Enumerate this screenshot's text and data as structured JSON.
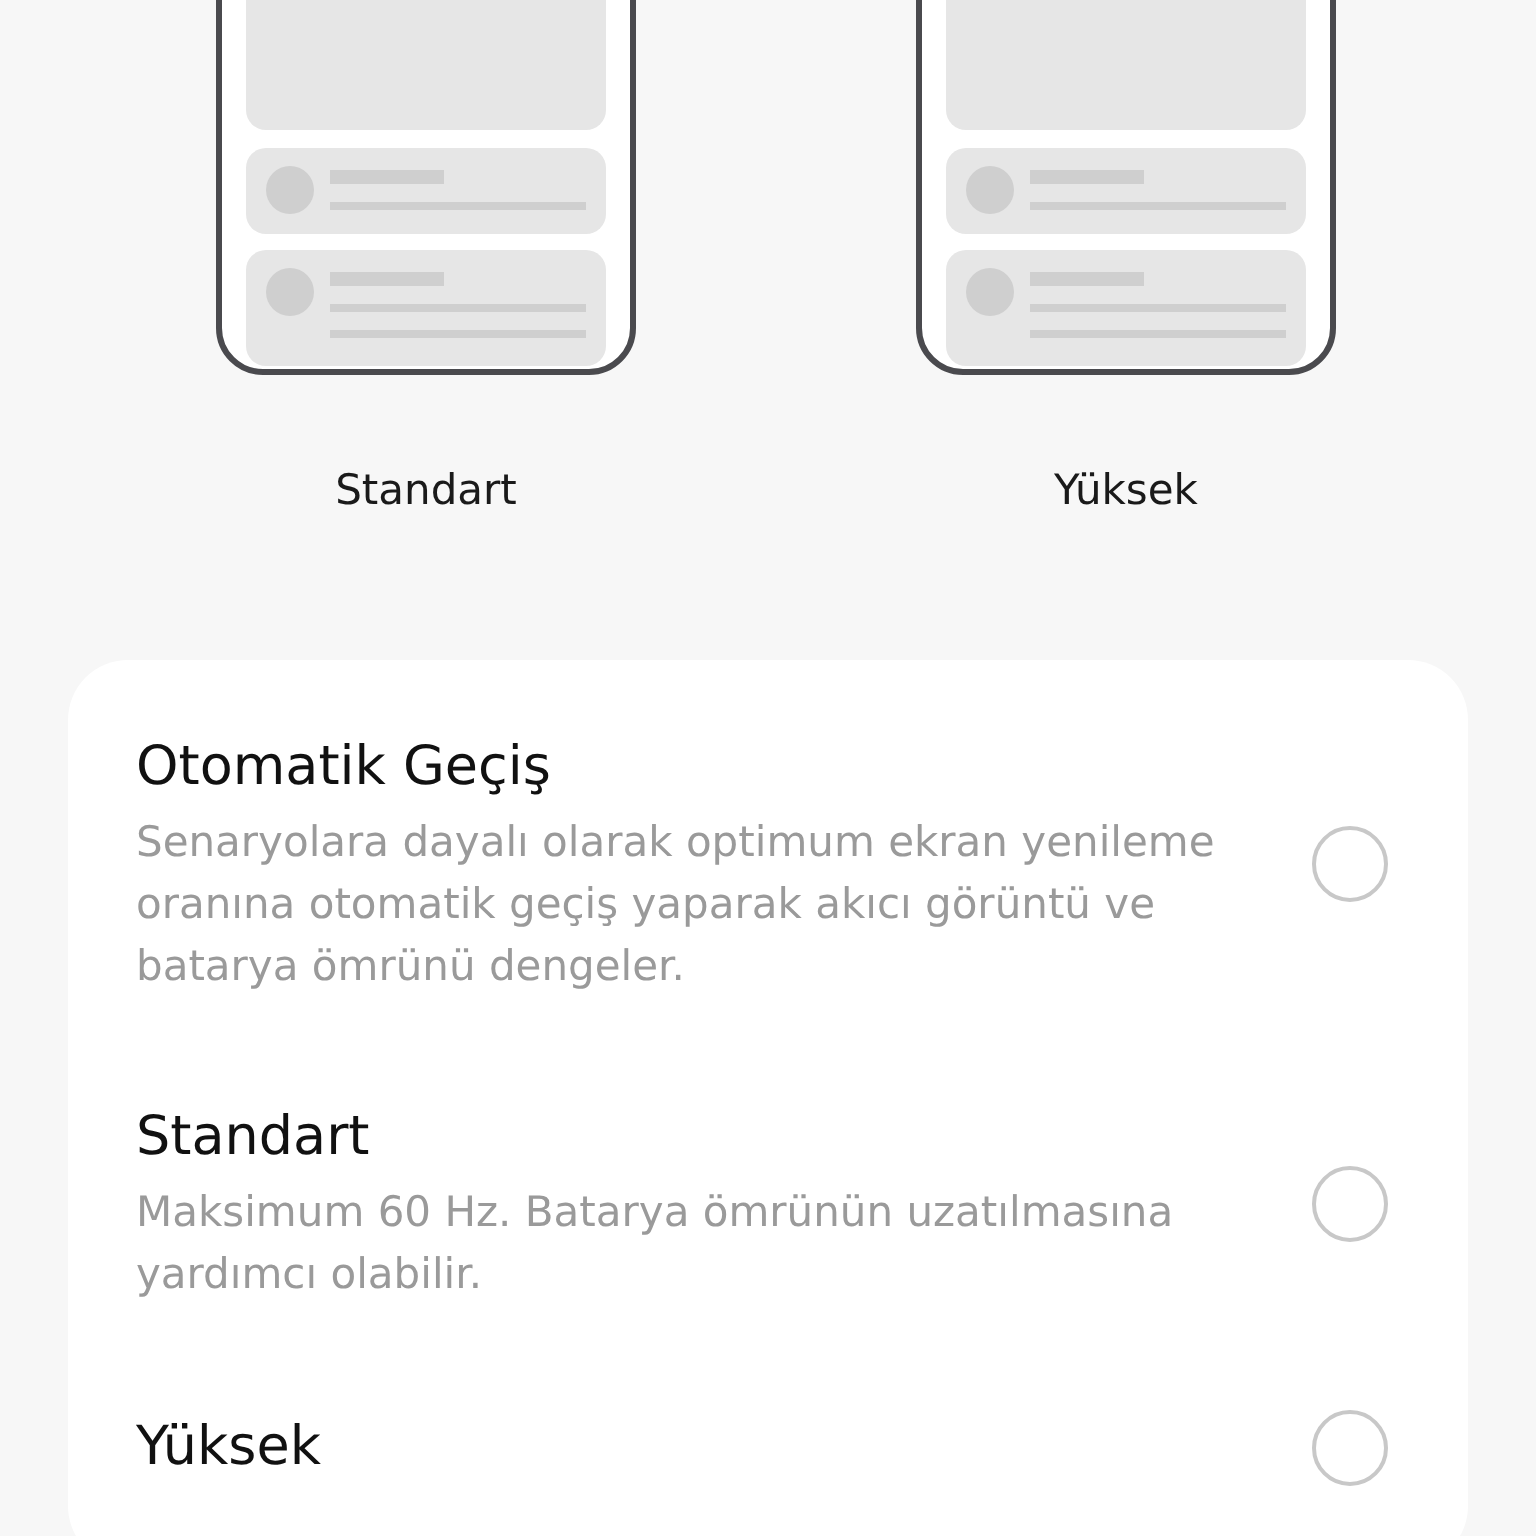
{
  "previews": [
    {
      "label": "Standart"
    },
    {
      "label": "Yüksek"
    }
  ],
  "options": [
    {
      "title": "Otomatik Geçiş",
      "description": "Senaryolara dayalı olarak optimum ekran yenileme oranına otomatik geçiş yaparak akıcı görüntü ve batarya ömrünü dengeler.",
      "selected": false
    },
    {
      "title": "Standart",
      "description": "Maksimum 60 Hz. Batarya ömrünün uzatılmasına yardımcı olabilir.",
      "selected": false
    },
    {
      "title": "Yüksek",
      "selected": false
    }
  ]
}
